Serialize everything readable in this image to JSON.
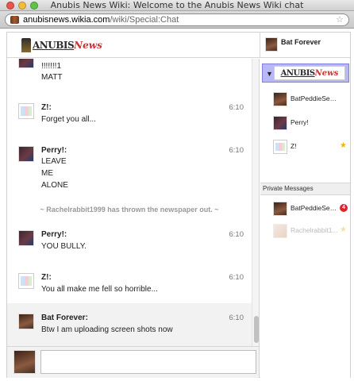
{
  "window": {
    "title": "Anubis News Wiki: Welcome to the Anubis News Wiki chat"
  },
  "address_bar": {
    "domain": "anubisnews.wikia.com",
    "path": "/wiki/Special:Chat",
    "favicon": "wikia-favicon-icon",
    "bookmark_icon": "star-icon"
  },
  "header": {
    "logo_anubis": "ANUBIS",
    "logo_news": "News",
    "current_user": "Bat Forever"
  },
  "messages": [
    {
      "author": "",
      "time": "",
      "lines": [
        "!!!!!!!1",
        "MATT"
      ],
      "avatar": "dark"
    },
    {
      "author": "Z!:",
      "time": "6:10",
      "lines": [
        "Forget you all..."
      ],
      "avatar": "light"
    },
    {
      "author": "Perry!:",
      "time": "6:10",
      "lines": [
        "LEAVE",
        "ME",
        "ALONE"
      ],
      "avatar": "dark"
    },
    {
      "author": "Perry!:",
      "time": "6:10",
      "lines": [
        "YOU BULLY."
      ],
      "avatar": "dark"
    },
    {
      "author": "Z!:",
      "time": "6:10",
      "lines": [
        "You all make me fell so horrible..."
      ],
      "avatar": "light"
    },
    {
      "author": "Bat Forever:",
      "time": "6:10",
      "lines": [
        "Btw I am uploading screen shots now"
      ],
      "avatar": "brown"
    }
  ],
  "inline_alert": "~ Rachelrabbit1999 has thrown the newspaper out. ~",
  "input": {
    "placeholder": ""
  },
  "sidebar": {
    "room": {
      "logo_anubis": "ANUBIS",
      "logo_news": "News",
      "arrow": "▼"
    },
    "users": [
      {
        "name": "BatPeddieSed...",
        "avatar": "brown",
        "star": false
      },
      {
        "name": "Perry!",
        "avatar": "dark",
        "star": false
      },
      {
        "name": "Z!",
        "avatar": "light",
        "star": true
      }
    ],
    "private_messages_label": "Private Messages",
    "private_users": [
      {
        "name": "BatPeddieSed...",
        "avatar": "brown",
        "badge": "4",
        "faded": false
      },
      {
        "name": "Rachelrabbit1...",
        "avatar": "faded",
        "star": true,
        "faded": true
      }
    ]
  },
  "colors": {
    "accent_room": "#b8b8f6",
    "badge": "#d8262d",
    "star": "#f4b400"
  }
}
